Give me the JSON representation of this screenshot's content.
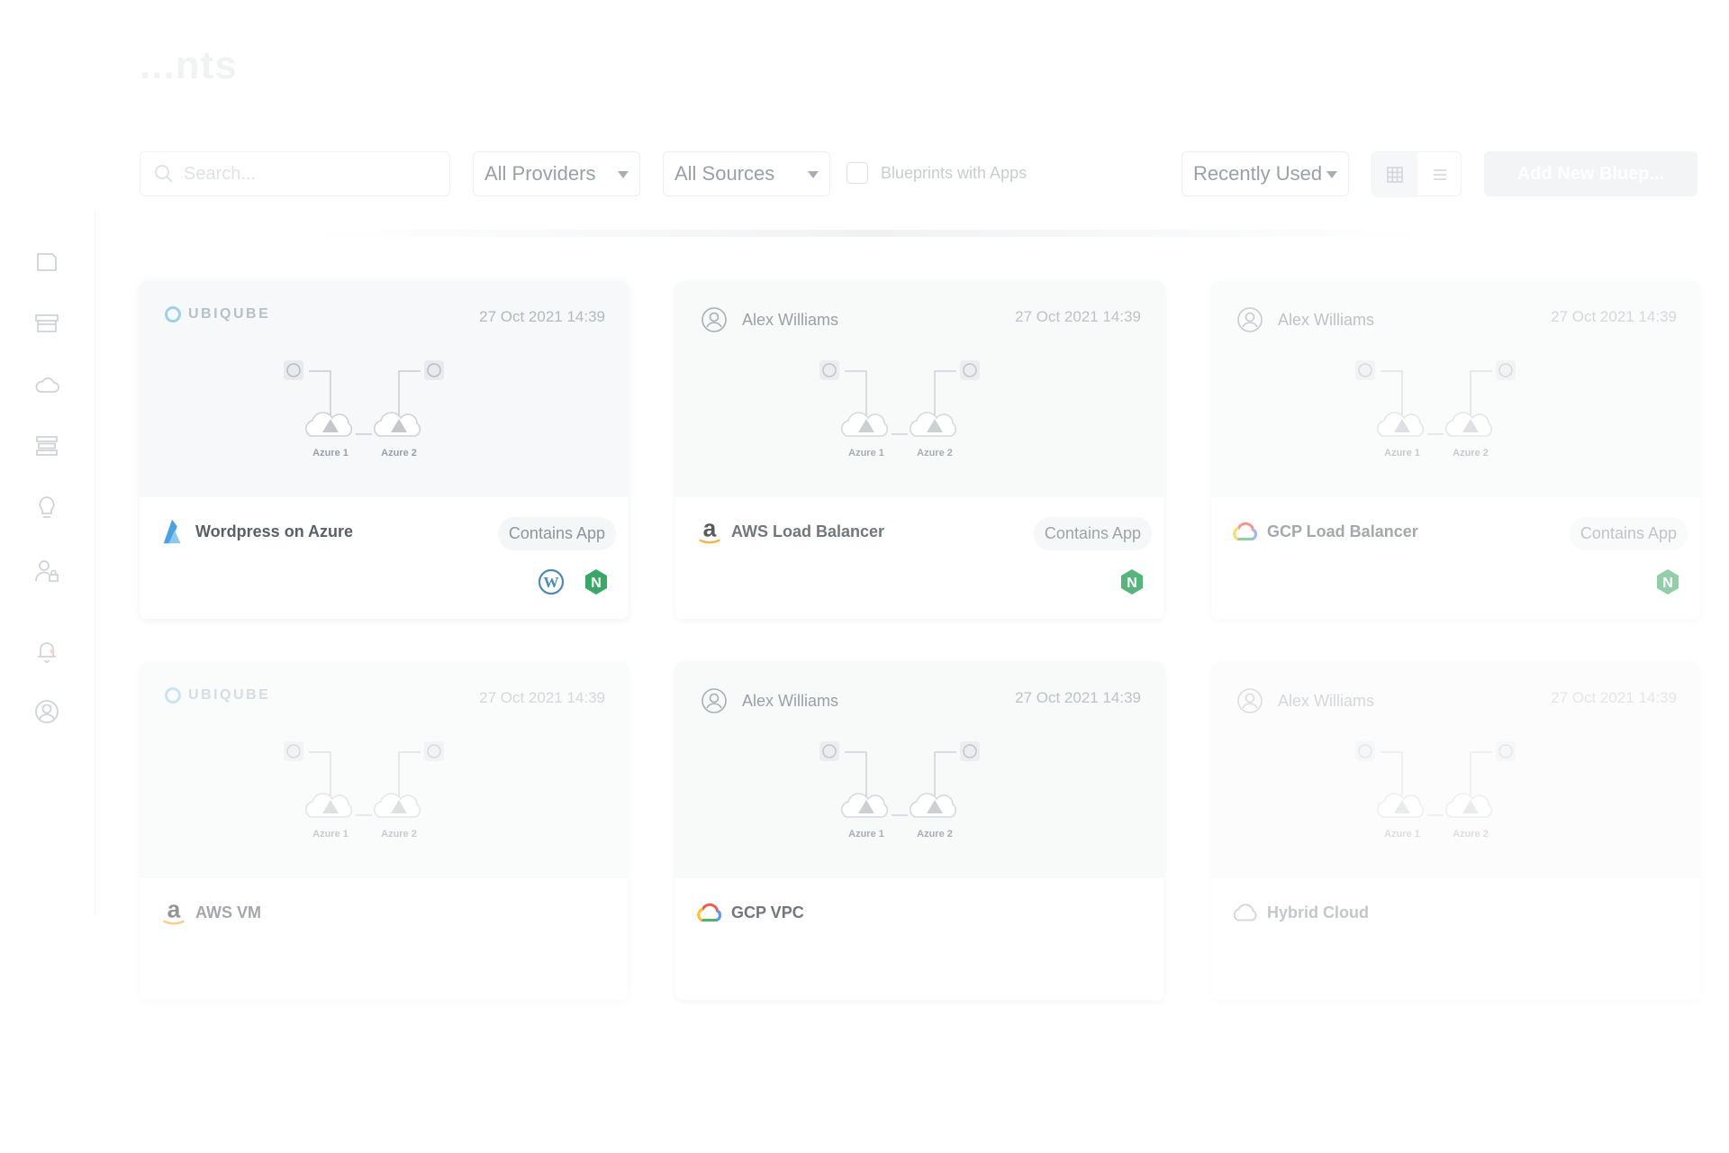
{
  "header": {
    "title": "...nts"
  },
  "toolbar": {
    "search_placeholder": "Search...",
    "providers_value": "All Providers",
    "sources_value": "All Sources",
    "apps_filter_label": "Blueprints with Apps",
    "sort_value": "Recently Used",
    "add_button_label": "Add New Bluep..."
  },
  "sidebar": {
    "items": [
      {
        "icon": "chat-icon"
      },
      {
        "icon": "storefront-icon"
      },
      {
        "icon": "cloud-icon"
      },
      {
        "icon": "stack-icon"
      },
      {
        "icon": "lightbulb-icon"
      },
      {
        "icon": "user-lock-icon"
      },
      {
        "icon": "bell-icon"
      },
      {
        "icon": "account-icon"
      }
    ]
  },
  "diagram": {
    "node1": "Azure 1",
    "node2": "Azure 2"
  },
  "cards": [
    {
      "owner": "UBIQUBE",
      "owner_type": "brand",
      "date": "27 Oct 2021 14:39",
      "title": "Wordpress on Azure",
      "provider_icon": "azure-logo-icon",
      "badge": "Contains App",
      "apps": [
        "wordpress-icon",
        "nginx-icon"
      ]
    },
    {
      "owner": "Alex Williams",
      "owner_type": "user",
      "date": "27 Oct 2021 14:39",
      "title": "AWS Load Balancer",
      "provider_icon": "aws-logo-icon",
      "badge": "Contains App",
      "apps": [
        "nginx-icon"
      ]
    },
    {
      "owner": "Alex Williams",
      "owner_type": "user",
      "date": "27 Oct 2021 14:39",
      "title": "GCP Load Balancer",
      "provider_icon": "gcp-logo-icon",
      "badge": "Contains App",
      "apps": [
        "nginx-icon"
      ]
    },
    {
      "owner": "UBIQUBE",
      "owner_type": "brand",
      "date": "27 Oct 2021 14:39",
      "title": "AWS VM",
      "provider_icon": "aws-logo-icon",
      "badge": "",
      "apps": []
    },
    {
      "owner": "Alex Williams",
      "owner_type": "user",
      "date": "27 Oct 2021 14:39",
      "title": "GCP VPC",
      "provider_icon": "gcp-logo-icon",
      "badge": "",
      "apps": []
    },
    {
      "owner": "Alex Williams",
      "owner_type": "user",
      "date": "27 Oct 2021 14:39",
      "title": "Hybrid Cloud",
      "provider_icon": "cloud-outline-icon",
      "badge": "",
      "apps": []
    }
  ]
}
